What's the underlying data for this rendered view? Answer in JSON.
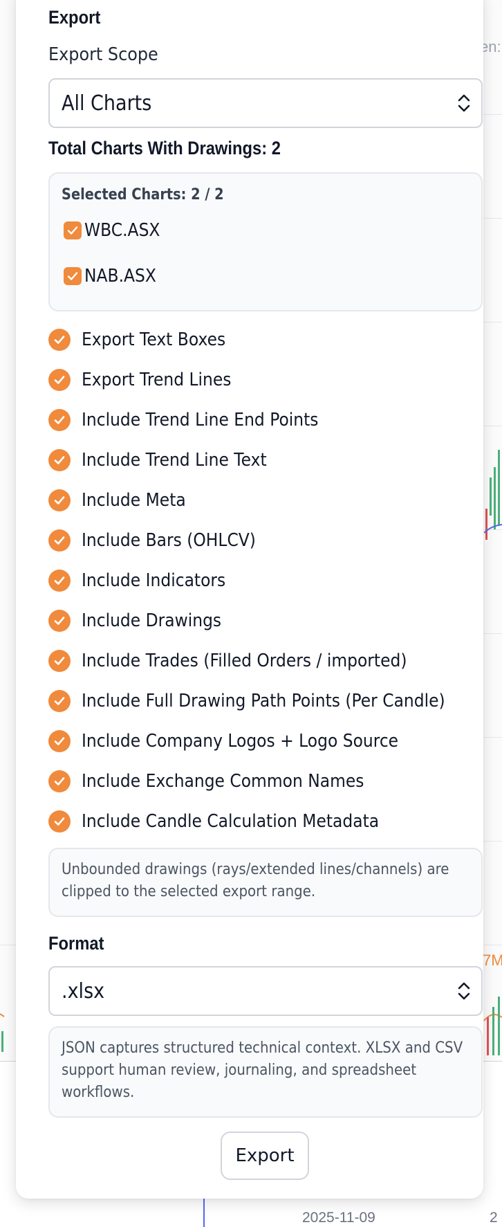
{
  "background": {
    "x_axis_date_label": "2025-11-09",
    "x_axis_partial_label": "2",
    "right_partial_text_top": "en:",
    "right_partial_text_mid": "7M"
  },
  "panel": {
    "title": "Export",
    "scope": {
      "label": "Export Scope",
      "selected": "All Charts"
    },
    "total_charts_label": "Total Charts With Drawings: 2",
    "selected_charts": {
      "title": "Selected Charts: 2 / 2",
      "items": [
        {
          "label": "WBC.ASX",
          "checked": true
        },
        {
          "label": "NAB.ASX",
          "checked": true
        }
      ]
    },
    "options": [
      {
        "label": "Export Text Boxes",
        "checked": true
      },
      {
        "label": "Export Trend Lines",
        "checked": true
      },
      {
        "label": "Include Trend Line End Points",
        "checked": true
      },
      {
        "label": "Include Trend Line Text",
        "checked": true
      },
      {
        "label": "Include Meta",
        "checked": true
      },
      {
        "label": "Include Bars (OHLCV)",
        "checked": true
      },
      {
        "label": "Include Indicators",
        "checked": true
      },
      {
        "label": "Include Drawings",
        "checked": true
      },
      {
        "label": "Include Trades (Filled Orders / imported)",
        "checked": true
      },
      {
        "label": "Include Full Drawing Path Points (Per Candle)",
        "checked": true
      },
      {
        "label": "Include Company Logos + Logo Source",
        "checked": true
      },
      {
        "label": "Include Exchange Common Names",
        "checked": true
      },
      {
        "label": "Include Candle Calculation Metadata",
        "checked": true
      }
    ],
    "clip_note": {
      "line1": "Unbounded drawings (rays/extended lines/channels) are",
      "line2": "clipped to the selected export range."
    },
    "format": {
      "label": "Format",
      "selected": ".xlsx"
    },
    "format_note": {
      "line1": "JSON captures structured technical context. XLSX and CSV",
      "line2": "support human review, journaling, and spreadsheet",
      "line3": "workflows."
    },
    "export_button": "Export"
  },
  "colors": {
    "accent": "#f08a3c",
    "border": "#d1d5db",
    "note_bg": "#f9fafb"
  }
}
